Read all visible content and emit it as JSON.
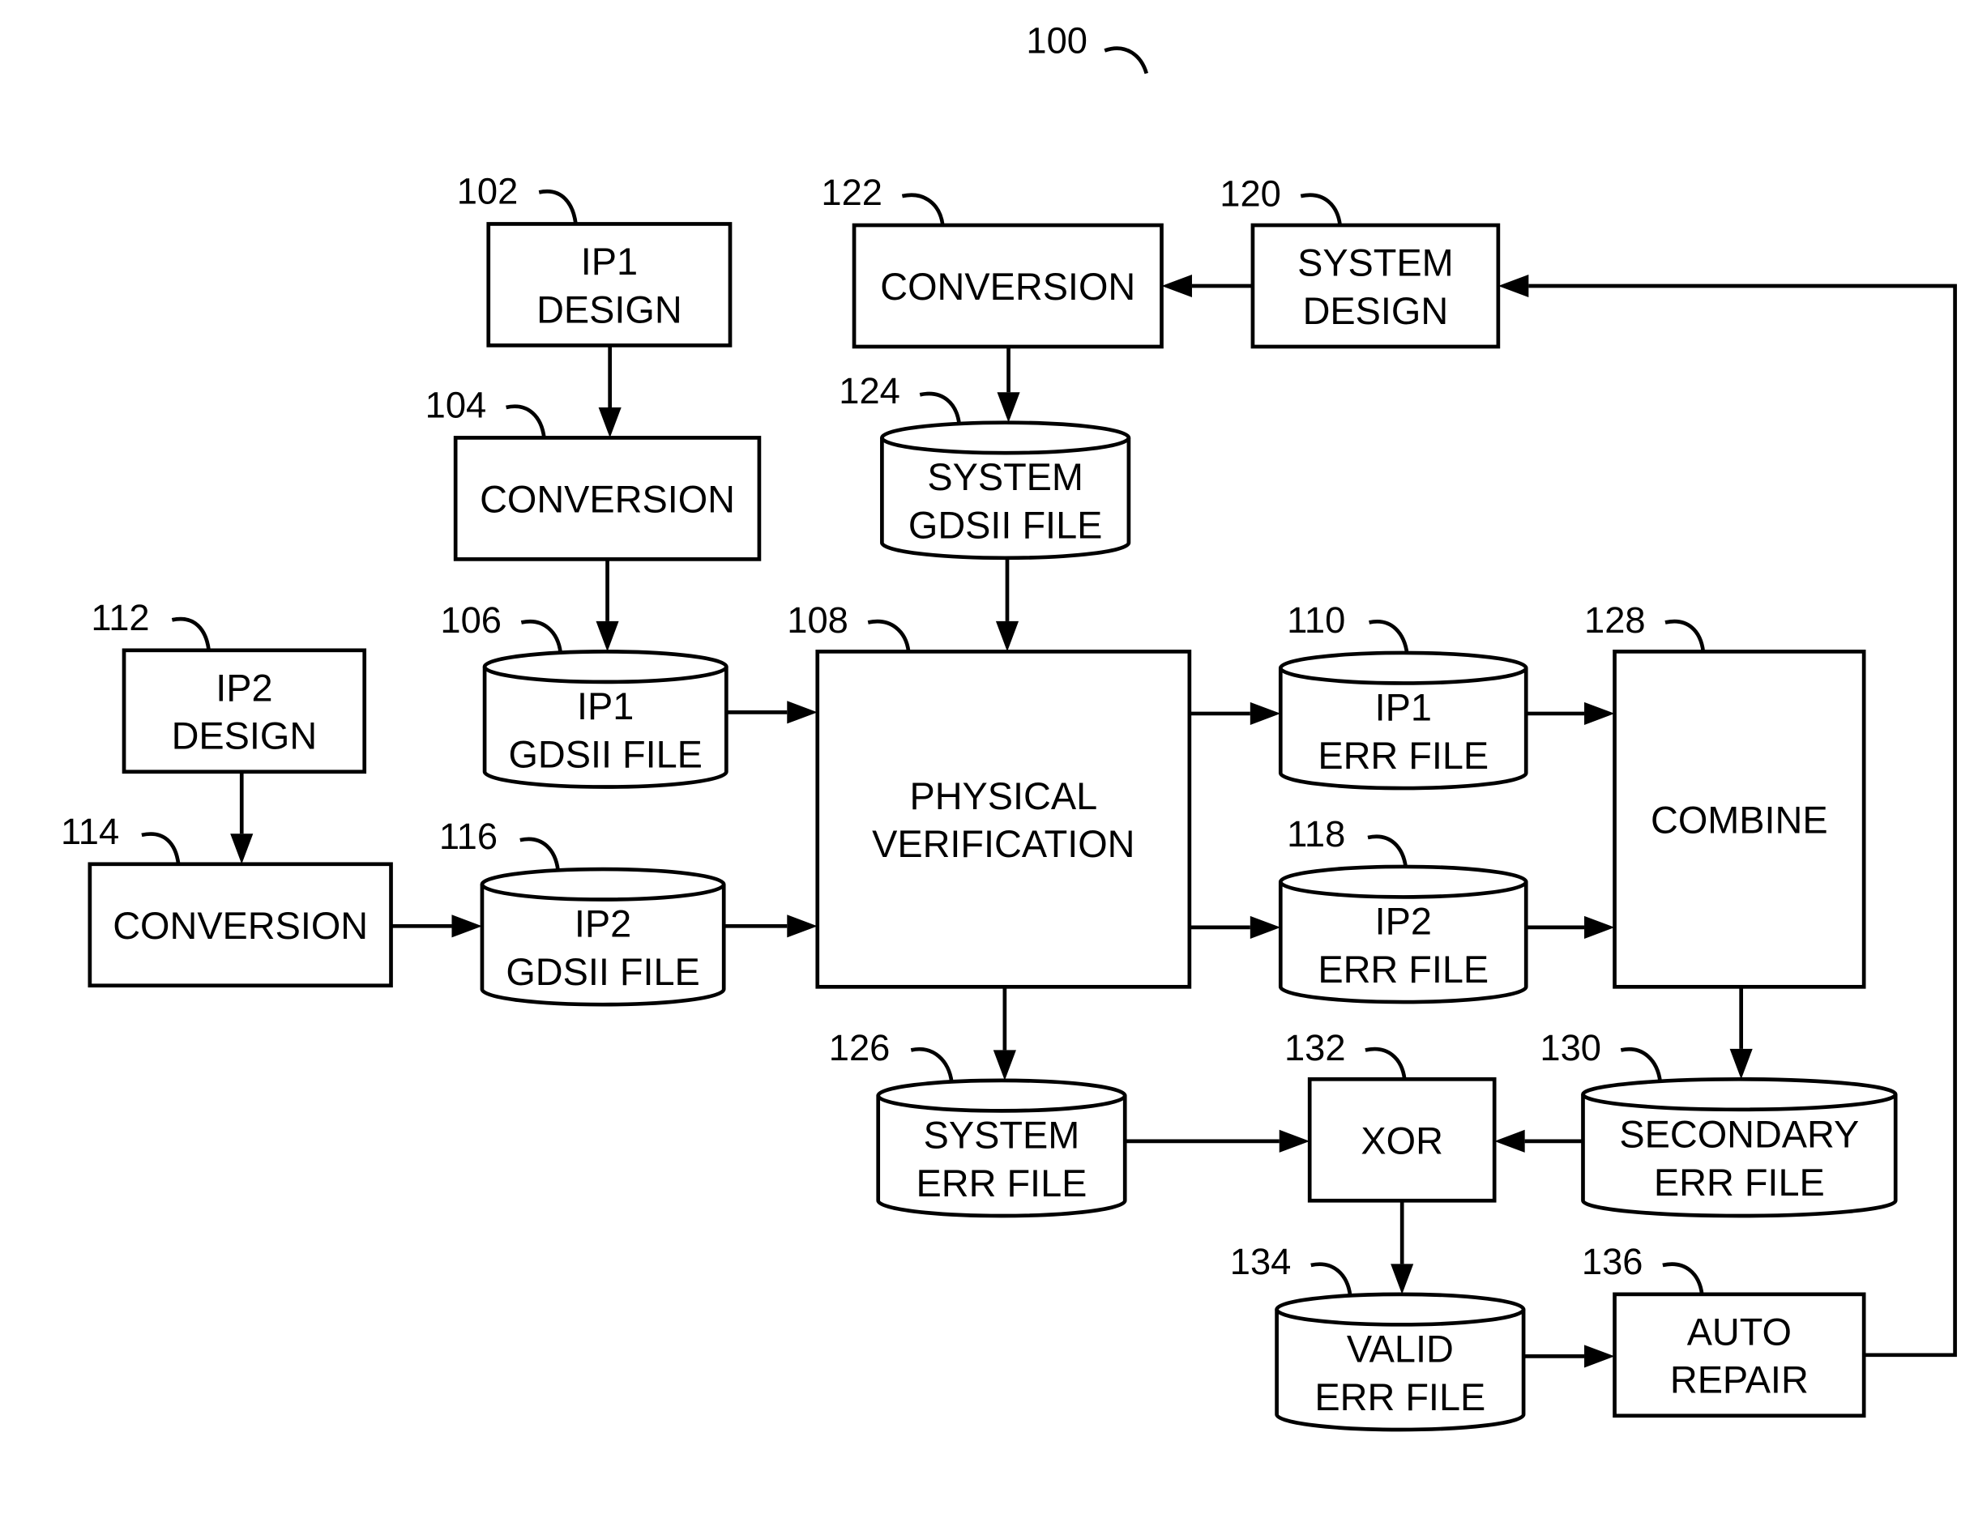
{
  "figure": {
    "ref": "100"
  },
  "nodes": {
    "ip1_design": {
      "ref": "102",
      "shape": "box",
      "lines": [
        "IP1",
        "DESIGN"
      ]
    },
    "ip1_conversion": {
      "ref": "104",
      "shape": "box",
      "lines": [
        "CONVERSION"
      ]
    },
    "ip1_gdsii_file": {
      "ref": "106",
      "shape": "cylinder",
      "lines": [
        "IP1",
        "GDSII FILE"
      ]
    },
    "physical_verif": {
      "ref": "108",
      "shape": "box",
      "lines": [
        "PHYSICAL",
        "VERIFICATION"
      ]
    },
    "ip1_err_file": {
      "ref": "110",
      "shape": "cylinder",
      "lines": [
        "IP1",
        "ERR FILE"
      ]
    },
    "ip2_design": {
      "ref": "112",
      "shape": "box",
      "lines": [
        "IP2",
        "DESIGN"
      ]
    },
    "ip2_conversion": {
      "ref": "114",
      "shape": "box",
      "lines": [
        "CONVERSION"
      ]
    },
    "ip2_gdsii_file": {
      "ref": "116",
      "shape": "cylinder",
      "lines": [
        "IP2",
        "GDSII FILE"
      ]
    },
    "ip2_err_file": {
      "ref": "118",
      "shape": "cylinder",
      "lines": [
        "IP2",
        "ERR FILE"
      ]
    },
    "system_design": {
      "ref": "120",
      "shape": "box",
      "lines": [
        "SYSTEM",
        "DESIGN"
      ]
    },
    "sys_conversion": {
      "ref": "122",
      "shape": "box",
      "lines": [
        "CONVERSION"
      ]
    },
    "system_gdsii_file": {
      "ref": "124",
      "shape": "cylinder",
      "lines": [
        "SYSTEM",
        "GDSII FILE"
      ]
    },
    "system_err_file": {
      "ref": "126",
      "shape": "cylinder",
      "lines": [
        "SYSTEM",
        "ERR FILE"
      ]
    },
    "combine": {
      "ref": "128",
      "shape": "box",
      "lines": [
        "COMBINE"
      ]
    },
    "secondary_err_file": {
      "ref": "130",
      "shape": "cylinder",
      "lines": [
        "SECONDARY",
        "ERR FILE"
      ]
    },
    "xor": {
      "ref": "132",
      "shape": "box",
      "lines": [
        "XOR"
      ]
    },
    "valid_err_file": {
      "ref": "134",
      "shape": "cylinder",
      "lines": [
        "VALID",
        "ERR FILE"
      ]
    },
    "auto_repair": {
      "ref": "136",
      "shape": "box",
      "lines": [
        "AUTO",
        "REPAIR"
      ]
    }
  },
  "edges": [
    {
      "from": "ip1_design",
      "to": "ip1_conversion"
    },
    {
      "from": "ip1_conversion",
      "to": "ip1_gdsii_file"
    },
    {
      "from": "ip1_gdsii_file",
      "to": "physical_verif"
    },
    {
      "from": "ip2_design",
      "to": "ip2_conversion"
    },
    {
      "from": "ip2_conversion",
      "to": "ip2_gdsii_file"
    },
    {
      "from": "ip2_gdsii_file",
      "to": "physical_verif"
    },
    {
      "from": "system_design",
      "to": "sys_conversion"
    },
    {
      "from": "sys_conversion",
      "to": "system_gdsii_file"
    },
    {
      "from": "system_gdsii_file",
      "to": "physical_verif"
    },
    {
      "from": "physical_verif",
      "to": "ip1_err_file"
    },
    {
      "from": "physical_verif",
      "to": "ip2_err_file"
    },
    {
      "from": "physical_verif",
      "to": "system_err_file"
    },
    {
      "from": "ip1_err_file",
      "to": "combine"
    },
    {
      "from": "ip2_err_file",
      "to": "combine"
    },
    {
      "from": "combine",
      "to": "secondary_err_file"
    },
    {
      "from": "system_err_file",
      "to": "xor"
    },
    {
      "from": "secondary_err_file",
      "to": "xor"
    },
    {
      "from": "xor",
      "to": "valid_err_file"
    },
    {
      "from": "valid_err_file",
      "to": "auto_repair"
    },
    {
      "from": "auto_repair",
      "to": "system_design"
    }
  ]
}
